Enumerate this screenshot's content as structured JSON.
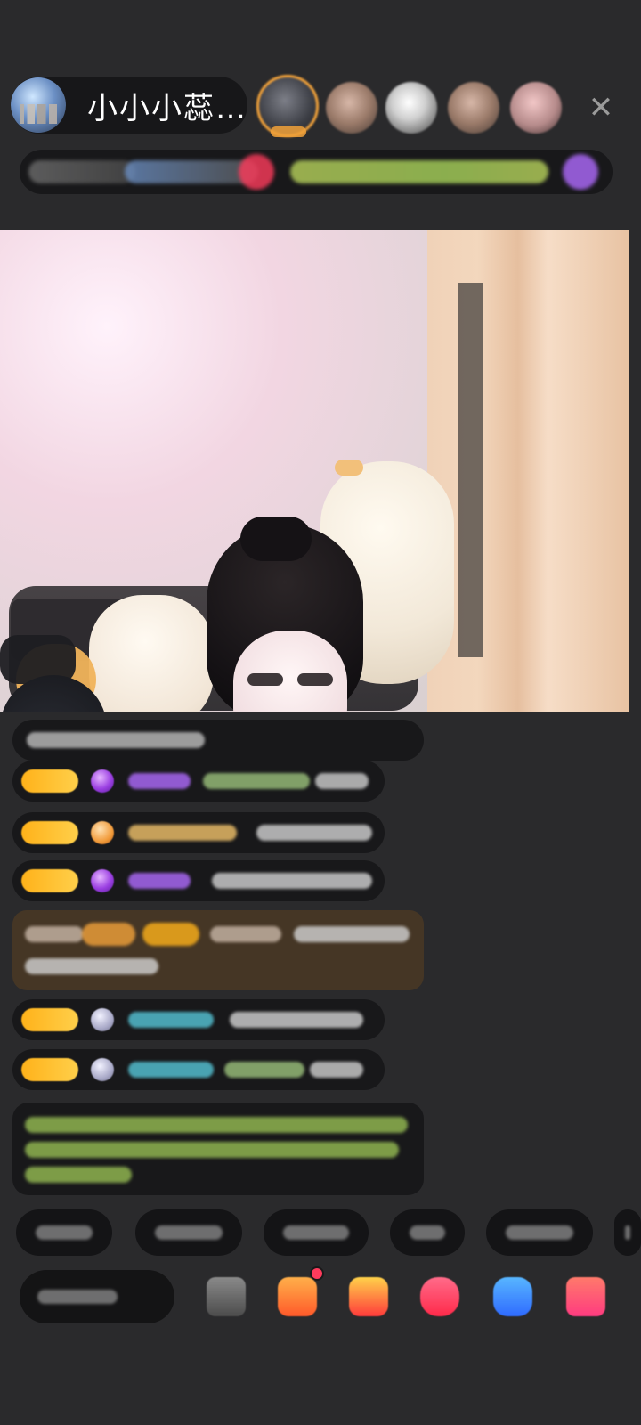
{
  "header": {
    "host_name": "小小小蕊…",
    "close_glyph": "✕",
    "viewer_count": 5
  },
  "video": {
    "label": ""
  },
  "chat": {
    "items": [
      {
        "type": "message"
      },
      {
        "type": "message"
      },
      {
        "type": "message"
      },
      {
        "type": "highlight"
      },
      {
        "type": "message"
      },
      {
        "type": "message"
      },
      {
        "type": "notice"
      }
    ]
  },
  "quick_replies": {
    "count": 6
  },
  "bottom_bar": {
    "actions": [
      "gift-box-icon",
      "red-envelope-icon",
      "shop-icon",
      "chat-icon",
      "games-icon",
      "more-icon"
    ]
  },
  "colors": {
    "background": "#2a2a2c",
    "badge_gold": "#ffb21a",
    "accent_purple": "#9b3fe2",
    "accent_orange": "#f29b3a",
    "accent_green": "#a8d45b",
    "accent_pink": "#ff3b5c"
  }
}
